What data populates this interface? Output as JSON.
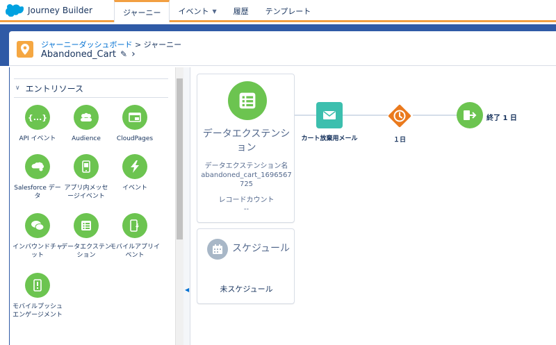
{
  "app": {
    "title": "Journey Builder"
  },
  "nav": {
    "tabs": [
      {
        "label": "ジャーニー",
        "active": true
      },
      {
        "label": "イベント",
        "has_dropdown": true
      },
      {
        "label": "履歴"
      },
      {
        "label": "テンプレート"
      }
    ]
  },
  "header": {
    "breadcrumb_link": "ジャーニーダッシュボード",
    "breadcrumb_sep": ">",
    "breadcrumb_current": "ジャーニー",
    "journey_name": "Abandoned_Cart"
  },
  "sidebar": {
    "section_title": "エントリソース",
    "items": [
      {
        "label": "API イベント",
        "icon": "api-braces-icon"
      },
      {
        "label": "Audience",
        "icon": "audience-people-icon"
      },
      {
        "label": "CloudPages",
        "icon": "cloudpages-icon"
      },
      {
        "label": "Salesforce データ",
        "icon": "salesforce-data-icon"
      },
      {
        "label": "アプリ内メッセージイベント",
        "icon": "in-app-message-icon"
      },
      {
        "label": "イベント",
        "icon": "lightning-event-icon"
      },
      {
        "label": "インバウンドチャット",
        "icon": "chat-bubbles-icon"
      },
      {
        "label": "データエクステンション",
        "icon": "data-extension-icon"
      },
      {
        "label": "モバイルアプリイベント",
        "icon": "mobile-app-event-icon"
      },
      {
        "label": "モバイルプッシュエンゲージメント",
        "icon": "mobile-push-icon"
      }
    ]
  },
  "canvas": {
    "entry_card": {
      "title": "データエクステンション",
      "de_name_label": "データエクステンション名",
      "de_name_value": "abandoned_cart_1696567725",
      "record_count_label": "レコードカウント",
      "record_count_value": "--"
    },
    "schedule_card": {
      "title": "スケジュール",
      "status": "未スケジュール"
    },
    "activities": [
      {
        "type": "email",
        "label": "カート放棄用メール",
        "color": "#3cbfae"
      },
      {
        "type": "wait",
        "label": "１日",
        "color": "#ea7a1e"
      },
      {
        "type": "exit",
        "label": "終了 1 日",
        "color": "#6cc450"
      }
    ]
  },
  "colors": {
    "accent_orange": "#f29f42",
    "header_blue": "#2f5aa6",
    "entry_green": "#6cc450",
    "link_blue": "#0070d2"
  }
}
